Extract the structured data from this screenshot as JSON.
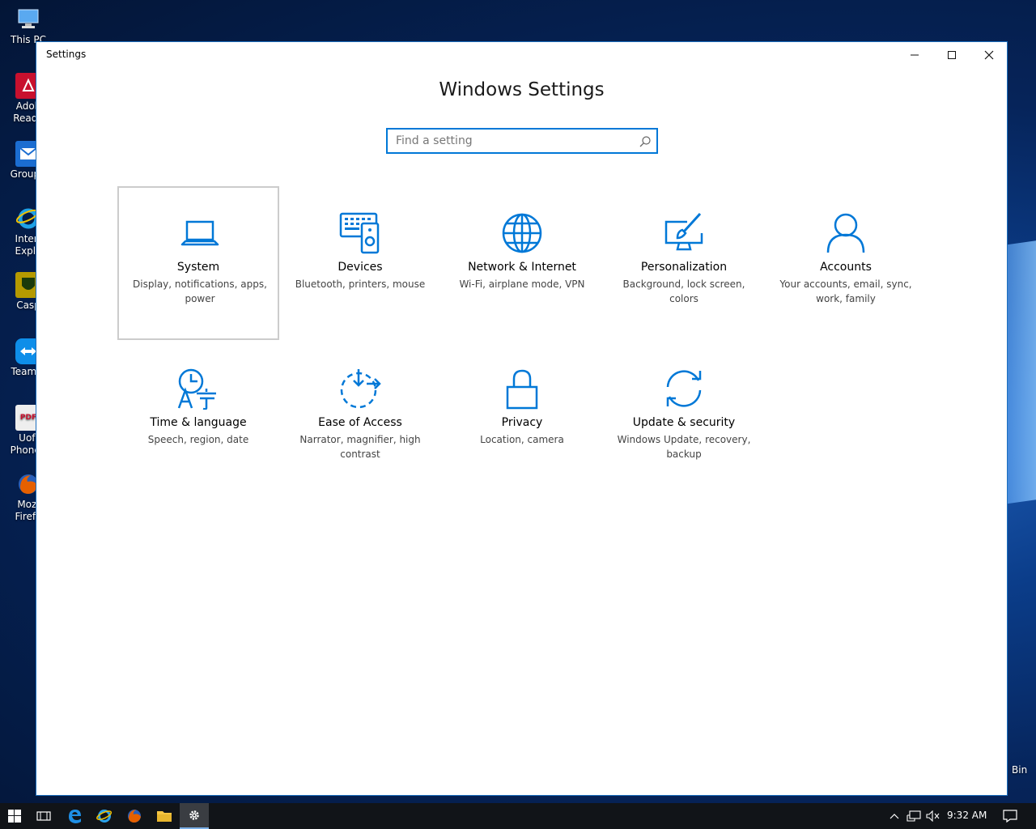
{
  "desktop": {
    "icons": [
      {
        "label": "This PC",
        "icon": "computer-icon",
        "color": "#3a8ee6"
      },
      {
        "label": "Adob\nReade",
        "icon": "adobe-reader-icon",
        "color": "#c8102e"
      },
      {
        "label": "GroupV",
        "icon": "groupwise-icon",
        "color": "#1b6dd1"
      },
      {
        "label": "Interr\nExplo",
        "icon": "internet-explorer-icon",
        "color": "#1ea1e6"
      },
      {
        "label": "Casp",
        "icon": "casper-icon",
        "color": "#b59a00"
      },
      {
        "label": "TeamVi",
        "icon": "teamviewer-icon",
        "color": "#0e8ee9"
      },
      {
        "label": "Uofl\nPhoneb",
        "icon": "pdf-icon",
        "color": "#c8102e"
      },
      {
        "label": "Mozi\nFirefo",
        "icon": "firefox-icon",
        "color": "#e66000"
      }
    ],
    "recycle_bin_label": "Bin"
  },
  "window": {
    "title": "Settings",
    "heading": "Windows Settings",
    "search_placeholder": "Find a setting",
    "accent": "#0078d7"
  },
  "tiles": [
    {
      "name": "System",
      "desc": "Display, notifications, apps, power",
      "icon": "laptop-icon"
    },
    {
      "name": "Devices",
      "desc": "Bluetooth, printers, mouse",
      "icon": "devices-icon"
    },
    {
      "name": "Network & Internet",
      "desc": "Wi-Fi, airplane mode, VPN",
      "icon": "globe-icon"
    },
    {
      "name": "Personalization",
      "desc": "Background, lock screen, colors",
      "icon": "personalization-icon"
    },
    {
      "name": "Accounts",
      "desc": "Your accounts, email, sync, work, family",
      "icon": "person-icon"
    },
    {
      "name": "Time & language",
      "desc": "Speech, region, date",
      "icon": "time-language-icon"
    },
    {
      "name": "Ease of Access",
      "desc": "Narrator, magnifier, high contrast",
      "icon": "ease-of-access-icon"
    },
    {
      "name": "Privacy",
      "desc": "Location, camera",
      "icon": "lock-icon"
    },
    {
      "name": "Update & security",
      "desc": "Windows Update, recovery, backup",
      "icon": "sync-icon"
    }
  ],
  "taskbar": {
    "time": "9:32 AM",
    "apps": [
      "task-view-icon",
      "edge-icon",
      "internet-explorer-icon",
      "firefox-icon",
      "file-explorer-icon",
      "settings-gear-icon"
    ]
  }
}
